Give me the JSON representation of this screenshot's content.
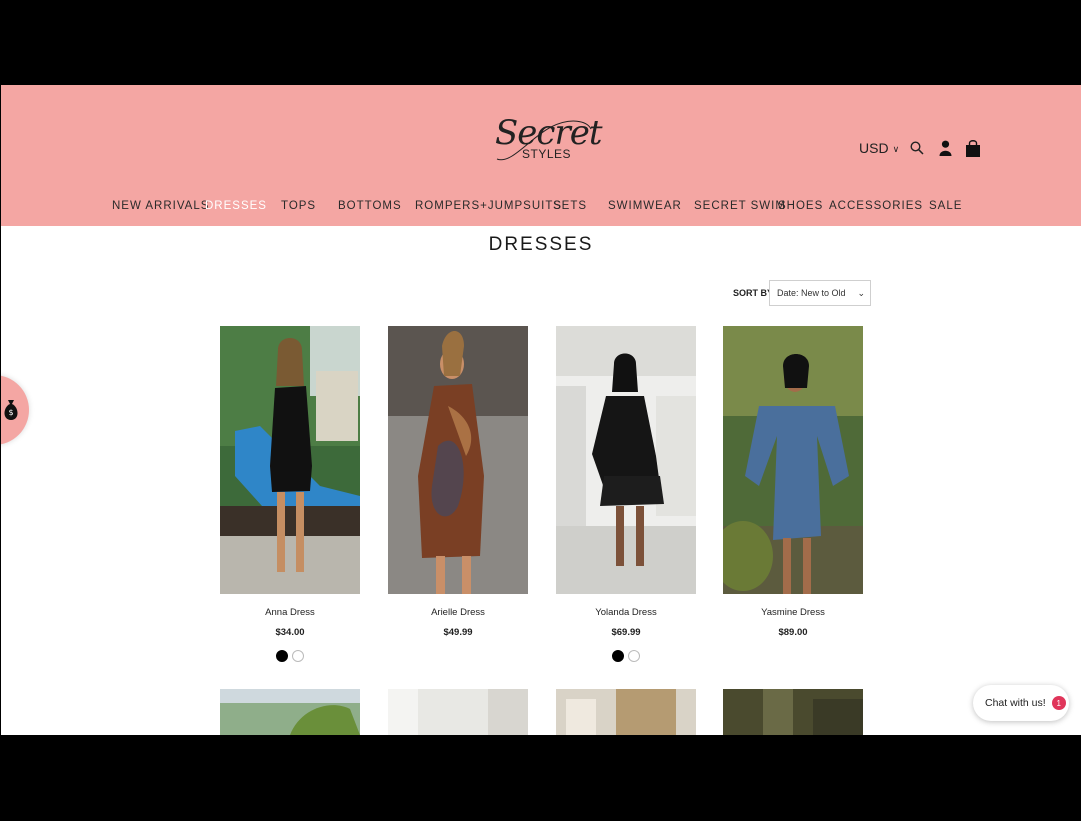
{
  "brand": {
    "logo_script": "Secret",
    "logo_sub": "STYLES"
  },
  "header": {
    "currency": "USD",
    "icons": [
      "search-icon",
      "account-icon",
      "cart-icon"
    ],
    "cart_count": "0"
  },
  "nav": {
    "items": [
      {
        "label": "NEW ARRIVALS"
      },
      {
        "label": "DRESSES"
      },
      {
        "label": "TOPS"
      },
      {
        "label": "BOTTOMS"
      },
      {
        "label": "ROMPERS+JUMPSUITS"
      },
      {
        "label": "SETS"
      },
      {
        "label": "SWIMWEAR"
      },
      {
        "label": "SECRET SWIM"
      },
      {
        "label": "SHOES"
      },
      {
        "label": "ACCESSORIES"
      },
      {
        "label": "SALE"
      }
    ],
    "active": "DRESSES"
  },
  "page": {
    "title": "DRESSES"
  },
  "sort": {
    "label": "SORT BY:",
    "value": "Date: New to Old"
  },
  "products": [
    {
      "name": "Anna Dress",
      "price": "$34.00",
      "swatches": [
        "black",
        "white"
      ]
    },
    {
      "name": "Arielle Dress",
      "price": "$49.99",
      "swatches": []
    },
    {
      "name": "Yolanda Dress",
      "price": "$69.99",
      "swatches": [
        "black",
        "white"
      ]
    },
    {
      "name": "Yasmine Dress",
      "price": "$89.00",
      "swatches": []
    }
  ],
  "chat": {
    "label": "Chat with us!",
    "badge": "1"
  },
  "colors": {
    "header_bg": "#f4a6a3",
    "active_nav": "#ffffff",
    "chat_badge": "#e0355a"
  }
}
